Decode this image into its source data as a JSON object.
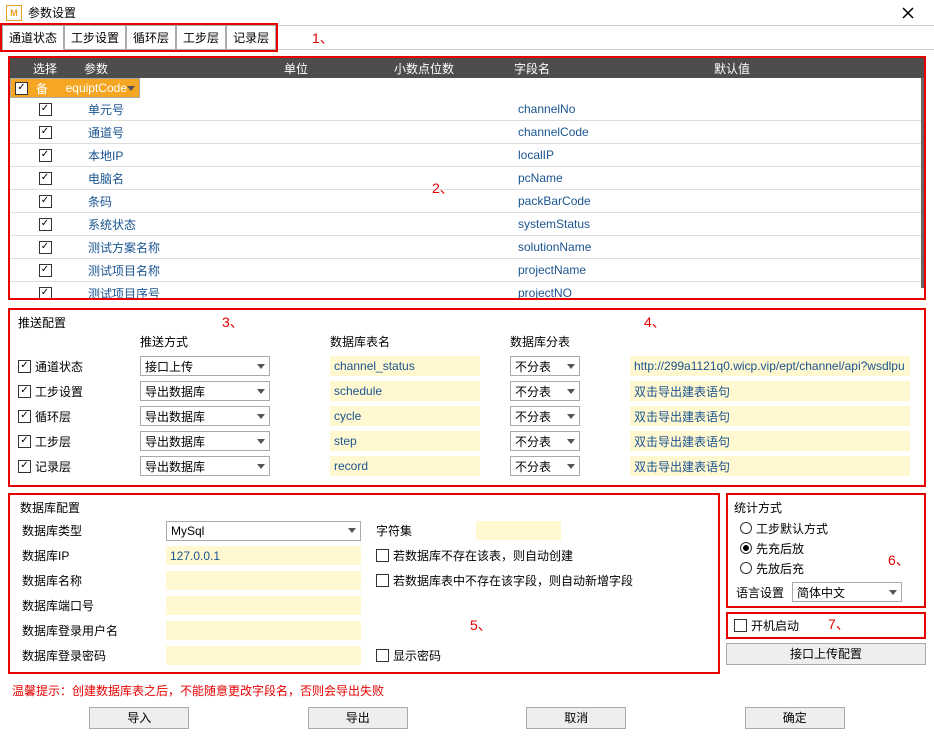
{
  "window": {
    "title": "参数设置"
  },
  "tabs": [
    "通道状态",
    "工步设置",
    "循环层",
    "工步层",
    "记录层"
  ],
  "annotations": {
    "a1": "1、",
    "a2": "2、",
    "a3": "3、",
    "a4": "4、",
    "a5": "5、",
    "a6": "6、",
    "a7": "7、"
  },
  "grid": {
    "headers": [
      "选择",
      "参数",
      "单位",
      "小数点位数",
      "字段名",
      "默认值"
    ],
    "rows": [
      {
        "param": "设备号",
        "field": "equiptCode",
        "selected": true,
        "checked": true
      },
      {
        "param": "单元号",
        "field": "channelNo",
        "checked": true
      },
      {
        "param": "通道号",
        "field": "channelCode",
        "checked": true
      },
      {
        "param": "本地IP",
        "field": "localIP",
        "checked": true
      },
      {
        "param": "电脑名",
        "field": "pcName",
        "checked": true
      },
      {
        "param": "条码",
        "field": "packBarCode",
        "checked": true
      },
      {
        "param": "系统状态",
        "field": "systemStatus",
        "checked": true
      },
      {
        "param": "测试方案名称",
        "field": "solutionName",
        "checked": true
      },
      {
        "param": "测试项目名称",
        "field": "projectName",
        "checked": true
      },
      {
        "param": "测试项目序号",
        "field": "projectNO",
        "checked": true
      }
    ]
  },
  "push": {
    "title": "推送配置",
    "headers": {
      "method": "推送方式",
      "table": "数据库表名",
      "split": "数据库分表"
    },
    "rows": [
      {
        "label": "通道状态",
        "method": "接口上传",
        "table": "channel_status",
        "split": "不分表",
        "extra": "http://299a1121q0.wicp.vip/ept/channel/api?wsdlpu"
      },
      {
        "label": "工步设置",
        "method": "导出数据库",
        "table": "schedule",
        "split": "不分表",
        "extra": "双击导出建表语句"
      },
      {
        "label": "循环层",
        "method": "导出数据库",
        "table": "cycle",
        "split": "不分表",
        "extra": "双击导出建表语句"
      },
      {
        "label": "工步层",
        "method": "导出数据库",
        "table": "step",
        "split": "不分表",
        "extra": "双击导出建表语句"
      },
      {
        "label": "记录层",
        "method": "导出数据库",
        "table": "record",
        "split": "不分表",
        "extra": "双击导出建表语句"
      }
    ]
  },
  "db": {
    "title": "数据库配置",
    "type_label": "数据库类型",
    "type_value": "MySql",
    "charset_label": "字符集",
    "ip_label": "数据库IP",
    "ip_value": "127.0.0.1",
    "auto_create_table": "若数据库不存在该表，则自动创建",
    "name_label": "数据库名称",
    "auto_add_col": "若数据库表中不存在该字段，则自动新增字段",
    "port_label": "数据库端口号",
    "user_label": "数据库登录用户名",
    "pwd_label": "数据库登录密码",
    "show_pwd": "显示密码"
  },
  "stat": {
    "title": "统计方式",
    "options": [
      "工步默认方式",
      "先充后放",
      "先放后充"
    ],
    "selected": 1,
    "lang_label": "语言设置",
    "lang_value": "简体中文"
  },
  "boot": {
    "label": "开机启动"
  },
  "iface_btn": "接口上传配置",
  "warn": "温馨提示：创建数据库表之后，不能随意更改字段名，否则会导出失败",
  "buttons": [
    "导入",
    "导出",
    "取消",
    "确定"
  ]
}
